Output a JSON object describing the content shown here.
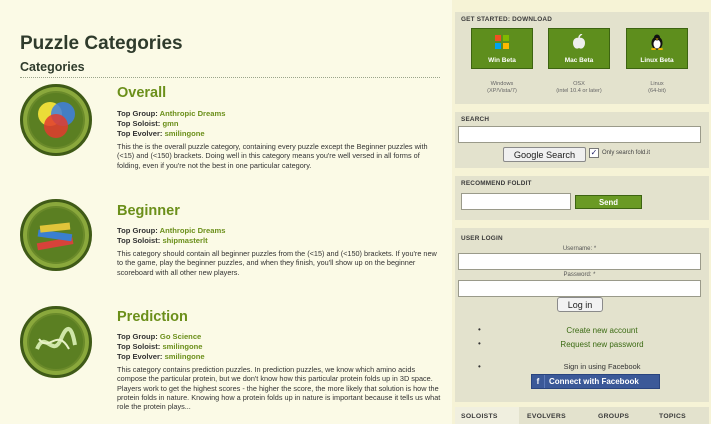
{
  "main": {
    "title": "Puzzle Categories",
    "section": "Categories",
    "categories": [
      {
        "name": "Overall",
        "meta": [
          {
            "label": "Top Group:",
            "value": "Anthropic Dreams"
          },
          {
            "label": "Top Soloist:",
            "value": "gmn"
          },
          {
            "label": "Top Evolver:",
            "value": "smilingone"
          }
        ],
        "description": "This the is the overall puzzle category, containing every puzzle except the Beginner puzzles with (<15) and (<150) brackets. Doing well in this category means you're well versed in all forms of folding, even if you're not the best in one particular category."
      },
      {
        "name": "Beginner",
        "meta": [
          {
            "label": "Top Group:",
            "value": "Anthropic Dreams"
          },
          {
            "label": "Top Soloist:",
            "value": "shipmasterlt"
          }
        ],
        "description": "This category should contain all beginner puzzles from the (<15) and (<150) brackets. If you're new to the game, play the beginner puzzles, and when they finish, you'll show up on the beginner scoreboard with all other new players."
      },
      {
        "name": "Prediction",
        "meta": [
          {
            "label": "Top Group:",
            "value": "Go Science"
          },
          {
            "label": "Top Soloist:",
            "value": "smilingone"
          },
          {
            "label": "Top Evolver:",
            "value": "smilingone"
          }
        ],
        "description": "This category contains prediction puzzles. In prediction puzzles, we know which amino acids compose the particular protein, but we don't know how this particular protein folds up in 3D space. Players work to get the highest scores - the higher the score, the more likely that solution is how the protein folds in nature. Knowing how a protein folds up in nature is important because it tells us what role the protein plays..."
      }
    ]
  },
  "sidebar": {
    "download": {
      "heading": "GET STARTED: DOWNLOAD",
      "buttons": [
        {
          "label": "Win Beta",
          "icon": "windows-icon",
          "note1": "Windows",
          "note2": "(XP/Vista/7)"
        },
        {
          "label": "Mac Beta",
          "icon": "apple-icon",
          "note1": "OSX",
          "note2": "(intel 10.4 or later)"
        },
        {
          "label": "Linux Beta",
          "icon": "linux-penguin-icon",
          "note1": "Linux",
          "note2": "(64-bit)"
        }
      ]
    },
    "search": {
      "heading": "SEARCH",
      "value": "",
      "button": "Google Search",
      "only_label": "Only search fold.it",
      "only_checked": true
    },
    "recommend": {
      "heading": "RECOMMEND FOLDIT",
      "value": "",
      "button": "Send"
    },
    "login": {
      "heading": "USER LOGIN",
      "username_label": "Username: *",
      "password_label": "Password: *",
      "button": "Log in",
      "create": "Create new account",
      "request": "Request new password",
      "fb_note": "Sign in using Facebook",
      "fb_button": "Connect with Facebook"
    },
    "tabs": [
      "SOLOISTS",
      "EVOLVERS",
      "GROUPS",
      "TOPICS"
    ]
  },
  "colors": {
    "accent_green": "#6b8f1a",
    "button_green": "#5e8e1d",
    "facebook_blue": "#3b5998",
    "page_bg": "#fbfae6",
    "sidebar_box": "#e3e2cd"
  }
}
